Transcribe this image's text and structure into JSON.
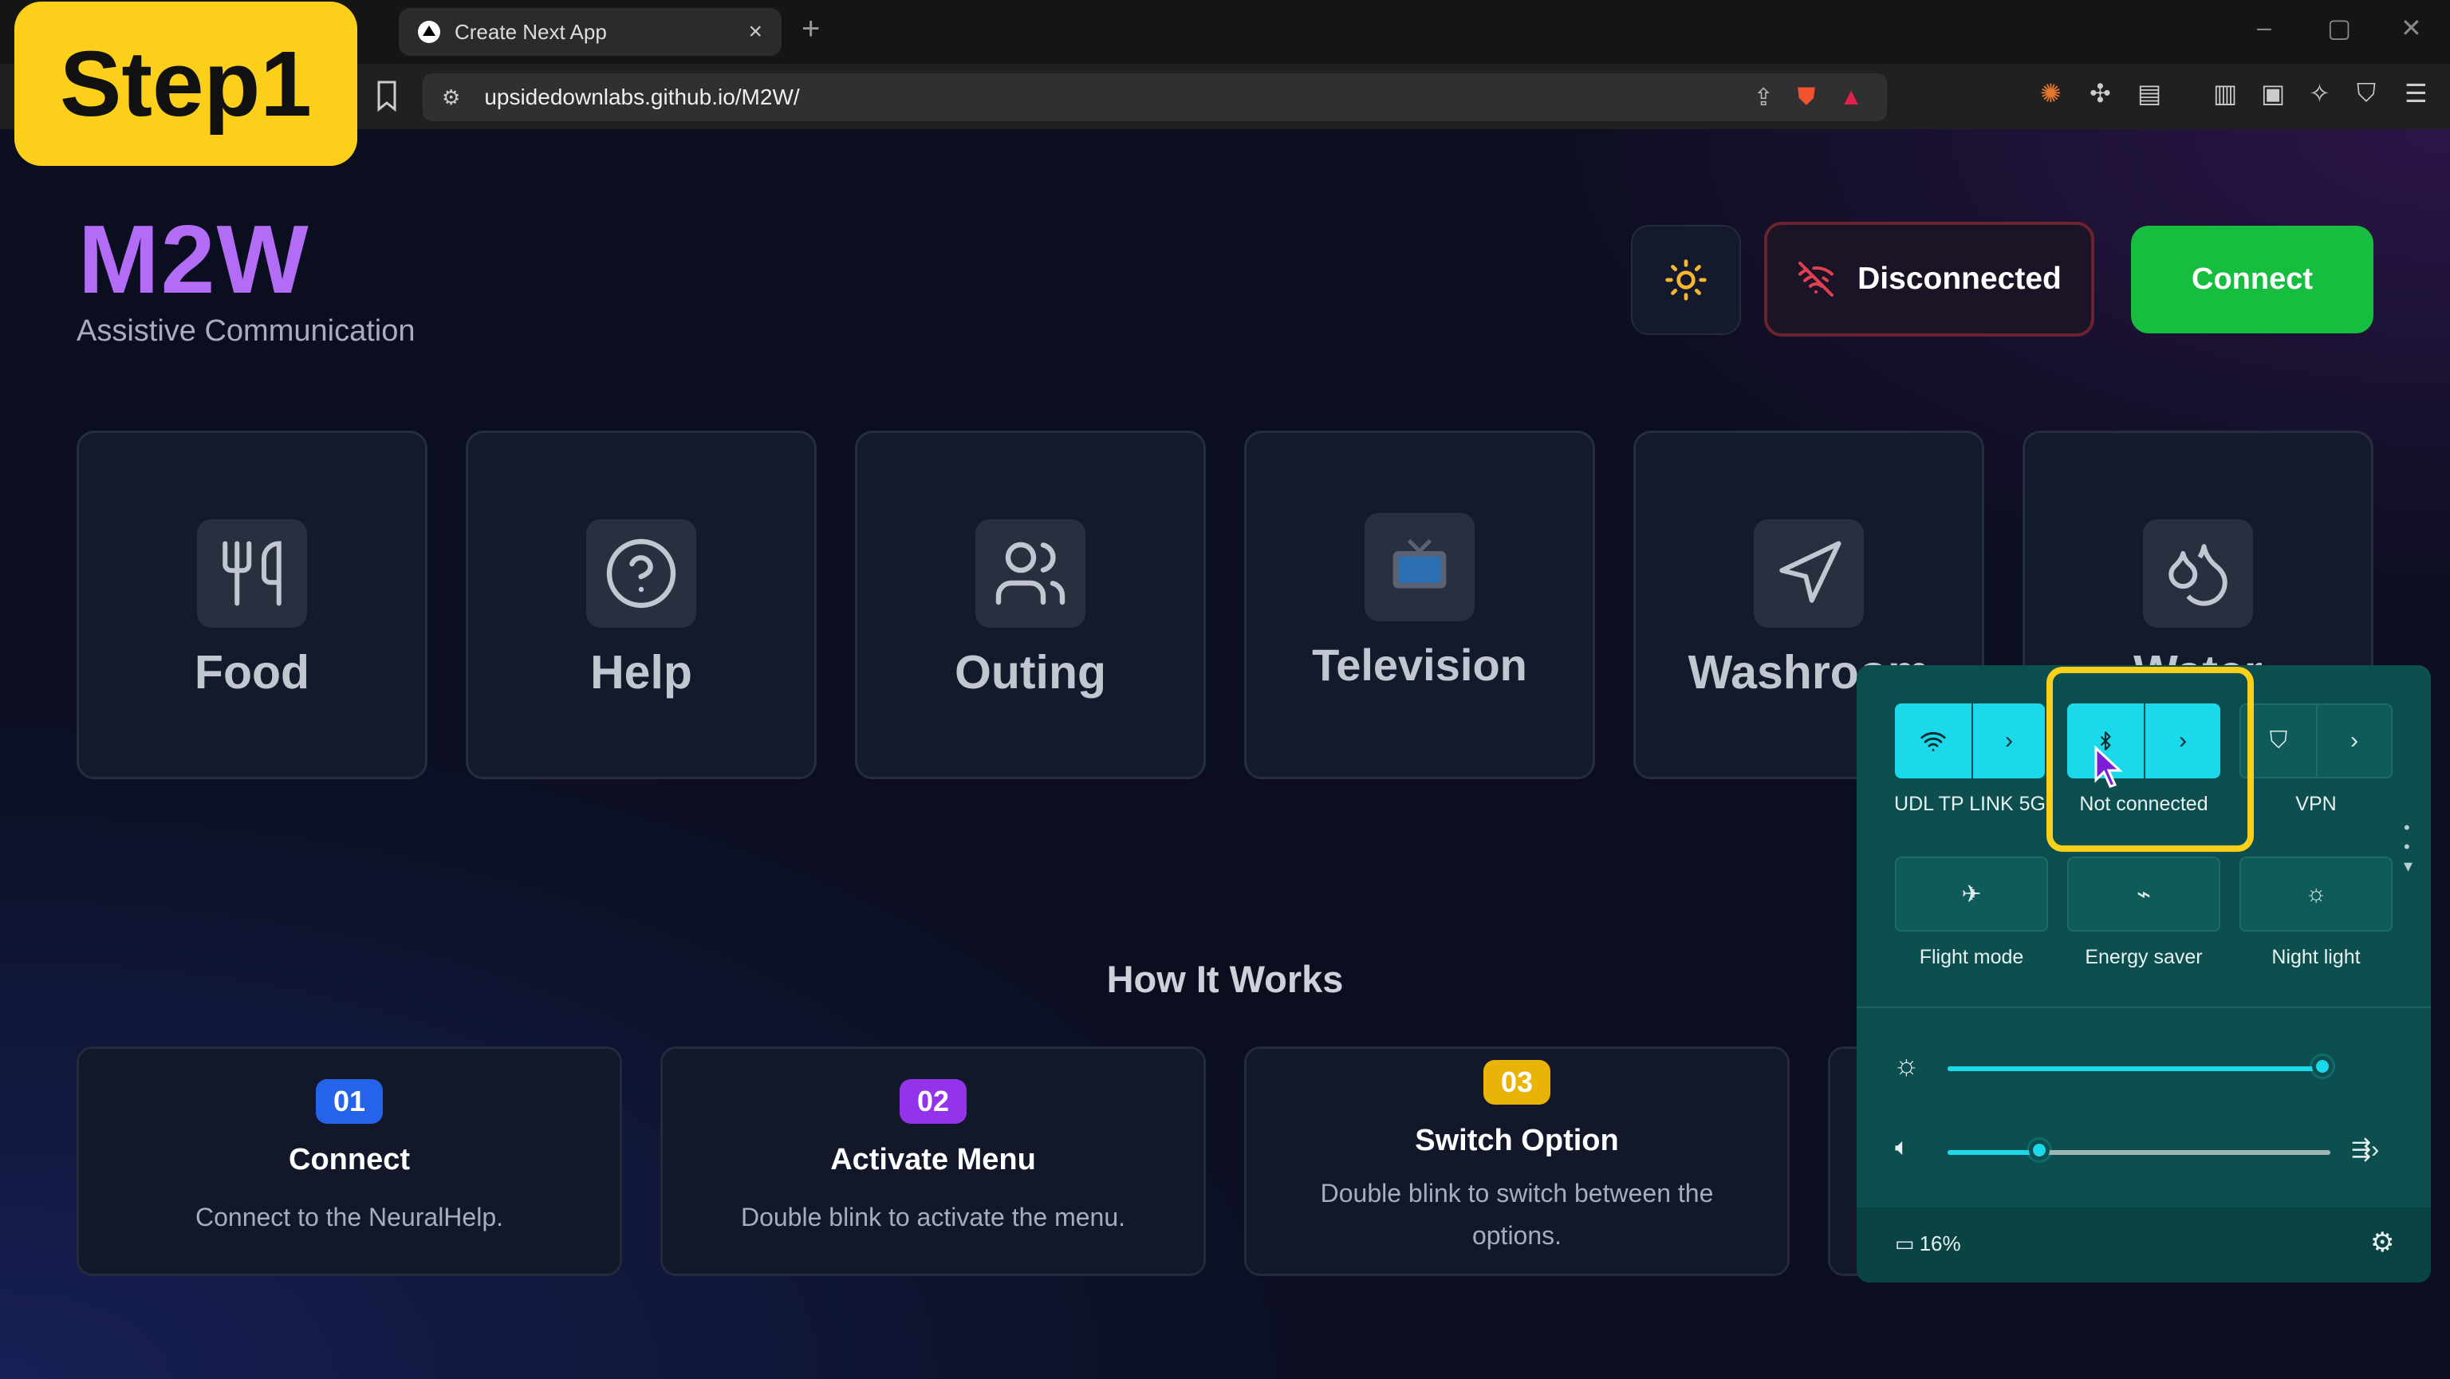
{
  "overlay": {
    "step_label": "Step1"
  },
  "browser": {
    "tab_title": "Create Next App",
    "tab_close": "×",
    "new_tab": "+",
    "url": "upsidedownlabs.github.io/M2W/",
    "window_controls": [
      "–",
      "▢",
      "✕"
    ]
  },
  "header": {
    "brand": "M2W",
    "subtitle": "Assistive Communication",
    "status_label": "Disconnected",
    "connect_label": "Connect"
  },
  "categories": [
    {
      "label": "Food",
      "icon": "utensils-icon"
    },
    {
      "label": "Help",
      "icon": "help-circle-icon"
    },
    {
      "label": "Outing",
      "icon": "users-icon"
    },
    {
      "label": "Television",
      "icon": "television-icon"
    },
    {
      "label": "Washroom",
      "icon": "navigation-icon"
    },
    {
      "label": "Water",
      "icon": "droplets-icon"
    }
  ],
  "how_it_works": {
    "title": "How It Works",
    "steps": [
      {
        "num": "01",
        "title": "Connect",
        "desc": "Connect to the NeuralHelp.",
        "color": "#2563eb"
      },
      {
        "num": "02",
        "title": "Activate Menu",
        "desc": "Double blink to activate the menu.",
        "color": "#9333ea"
      },
      {
        "num": "03",
        "title": "Switch Option",
        "desc": "Double blink to switch between the options.",
        "color": "#eab308"
      }
    ]
  },
  "quick_settings": {
    "wifi_label": "UDL TP LINK 5G",
    "bluetooth_label": "Not connected",
    "vpn_label": "VPN",
    "flight_label": "Flight mode",
    "energy_label": "Energy saver",
    "night_label": "Night light",
    "brightness_fraction": 0.99,
    "volume_fraction": 0.25,
    "battery": "16%"
  },
  "colors": {
    "accent": "#b26cf5",
    "connect": "#17bd3e",
    "qs_bg": "#0d4f4e",
    "qs_on": "#1bd9ea",
    "highlight": "#fcd01a"
  }
}
